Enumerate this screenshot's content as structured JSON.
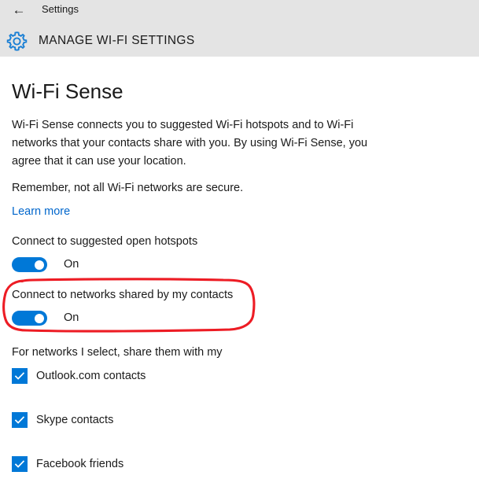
{
  "titlebar": {
    "back_icon": "back-arrow-icon",
    "app_name": "Settings"
  },
  "header": {
    "icon": "gear-icon",
    "title": "MANAGE WI-FI SETTINGS"
  },
  "main": {
    "section_title": "Wi-Fi Sense",
    "description": "Wi-Fi Sense connects you to suggested Wi-Fi hotspots and to Wi-Fi networks that your contacts share with you. By using Wi-Fi Sense, you agree that it can use your location.",
    "security_note": "Remember, not all Wi-Fi networks are secure.",
    "learn_more": "Learn more",
    "toggles": [
      {
        "label": "Connect to suggested open hotspots",
        "state": "On",
        "checked": true
      },
      {
        "label": "Connect to networks shared by my contacts",
        "state": "On",
        "checked": true,
        "annotated": true
      }
    ],
    "share_heading": "For networks I select, share them with my",
    "checkboxes": [
      {
        "label": "Outlook.com contacts",
        "checked": true
      },
      {
        "label": "Skype contacts",
        "checked": true
      },
      {
        "label": "Facebook friends",
        "checked": true
      }
    ]
  },
  "annotation": {
    "shape": "hand-drawn-ellipse",
    "color": "#ed1c24",
    "targets": "Connect to networks shared by my contacts"
  },
  "colors": {
    "accent": "#0078d7",
    "link": "#0066cc",
    "header_band": "#e4e4e4",
    "page_background": "#ffffff",
    "text": "#1a1a1a",
    "annotation_red": "#ed1c24"
  }
}
